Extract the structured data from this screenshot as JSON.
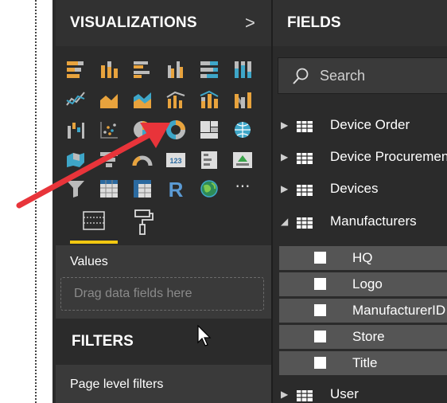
{
  "visualizations": {
    "title": "VISUALIZATIONS",
    "collapse_glyph": ">",
    "icons": [
      "stacked-bar-chart-icon",
      "stacked-column-chart-icon",
      "clustered-bar-chart-icon",
      "clustered-column-chart-icon",
      "100-stacked-bar-chart-icon",
      "100-stacked-column-chart-icon",
      "line-chart-icon",
      "area-chart-icon",
      "stacked-area-chart-icon",
      "line-clustered-column-chart-icon",
      "line-stacked-column-chart-icon",
      "ribbon-chart-icon",
      "waterfall-chart-icon",
      "scatter-chart-icon",
      "pie-chart-icon",
      "donut-chart-icon",
      "treemap-icon",
      "map-icon",
      "filled-map-icon",
      "funnel-icon",
      "gauge-icon",
      "card-icon",
      "multi-row-card-icon",
      "kpi-icon",
      "slicer-icon",
      "table-icon",
      "matrix-icon",
      "r-visual-icon",
      "globe-icon",
      "more-visuals-icon"
    ],
    "r_glyph": "R",
    "card_glyph": "123",
    "more_glyph": "···",
    "values_label": "Values",
    "drop_placeholder": "Drag data fields here",
    "filters_title": "FILTERS",
    "page_filters_label": "Page level filters"
  },
  "fields": {
    "title": "FIELDS",
    "search_placeholder": "Search",
    "tables": [
      {
        "label": "Device Order",
        "expanded": false
      },
      {
        "label": "Device Procurement",
        "expanded": false
      },
      {
        "label": "Devices",
        "expanded": false
      },
      {
        "label": "Manufacturers",
        "expanded": true
      },
      {
        "label": "User",
        "expanded": false
      }
    ],
    "manufacturer_fields": [
      "HQ",
      "Logo",
      "ManufacturerID",
      "Store",
      "Title"
    ]
  },
  "colors": {
    "pane_bg": "#2b2b2b",
    "accent_yellow": "#f2c811",
    "annotation_arrow": "#e8343a",
    "chart_orange": "#e8a33d",
    "chart_teal": "#3ea6c8"
  }
}
